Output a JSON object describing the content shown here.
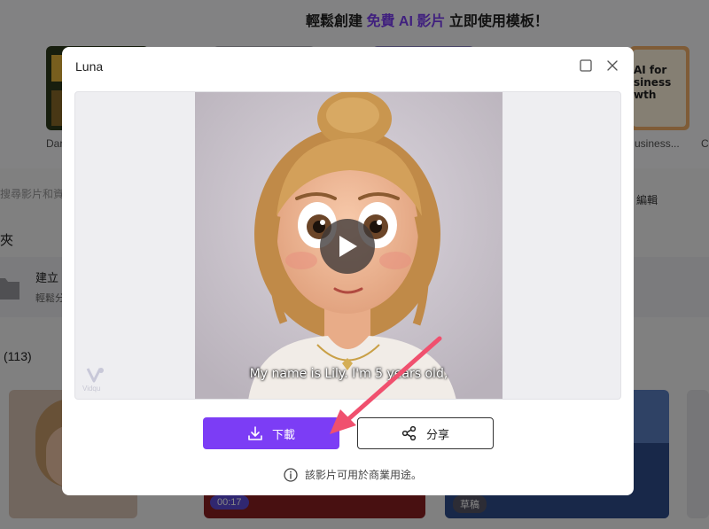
{
  "banner": {
    "title_pre": "輕鬆創建",
    "title_hl": "免費 AI 影片",
    "title_post": "立即使用模板！",
    "template_labels": [
      "Dar",
      "usiness...",
      "C"
    ],
    "ai_card_text": "AI for\nsiness\nwth"
  },
  "search": {
    "placeholder": "搜尋影片和資",
    "edit_label": "編輯"
  },
  "folders": {
    "title": "夾",
    "create_title": "建立",
    "create_sub": "輕鬆分"
  },
  "videos": {
    "count": "(113)",
    "badges": [
      "00:17",
      "草稿"
    ]
  },
  "modal": {
    "title": "Luna",
    "subtitle_text": "My name is Lily. I'm 5 years old,",
    "watermark": "Vidqu",
    "download_label": "下載",
    "share_label": "分享",
    "note": "該影片可用於商業用途。"
  },
  "colors": {
    "accent": "#7c3df5",
    "arrow": "#f0506e"
  }
}
